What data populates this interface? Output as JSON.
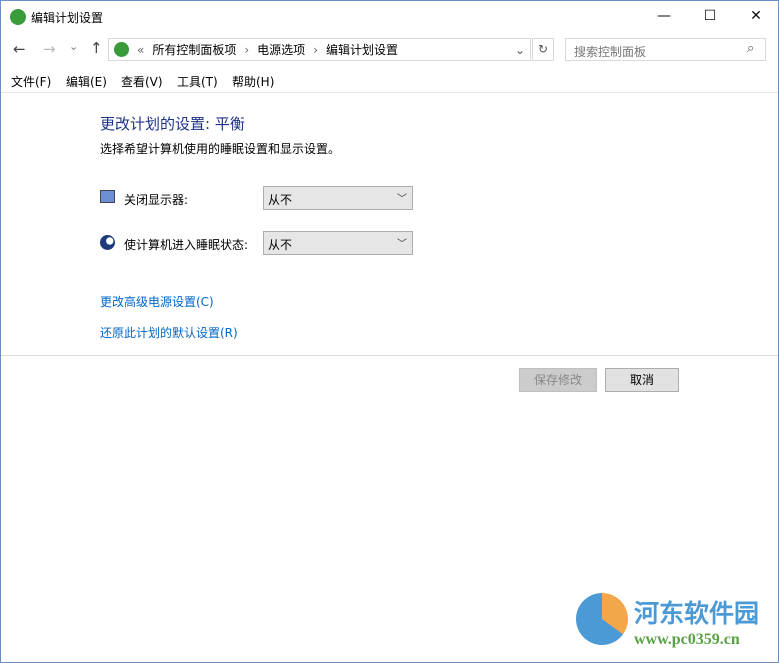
{
  "window": {
    "title": "编辑计划设置",
    "minimize": "—",
    "maximize": "☐",
    "close": "✕"
  },
  "nav": {
    "back": "←",
    "forward": "→",
    "recent": "⌄",
    "up": "↑",
    "refresh": "↻",
    "dropdown": "⌄"
  },
  "address": {
    "overflow": "«",
    "crumbs": [
      "所有控制面板项",
      "电源选项",
      "编辑计划设置"
    ],
    "sep": "›"
  },
  "search": {
    "placeholder": "搜索控制面板",
    "icon": "⌕"
  },
  "menu": [
    "文件(F)",
    "编辑(E)",
    "查看(V)",
    "工具(T)",
    "帮助(H)"
  ],
  "main": {
    "heading": "更改计划的设置: 平衡",
    "subtitle": "选择希望计算机使用的睡眠设置和显示设置。",
    "settings": [
      {
        "label": "关闭显示器:",
        "value": "从不"
      },
      {
        "label": "使计算机进入睡眠状态:",
        "value": "从不"
      }
    ],
    "links": [
      "更改高级电源设置(C)",
      "还原此计划的默认设置(R)"
    ],
    "save": "保存修改",
    "cancel": "取消"
  },
  "watermark": {
    "name": "河东软件园",
    "url": "www.pc0359.cn"
  }
}
